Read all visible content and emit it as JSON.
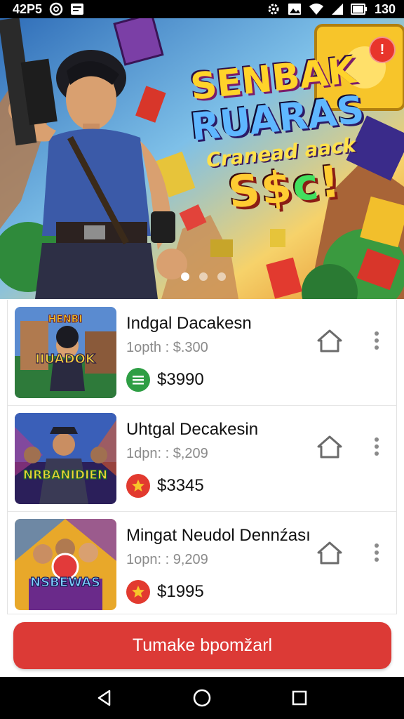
{
  "status_bar": {
    "left_text": "42P5",
    "right_text": "130",
    "icons": [
      "at-icon",
      "app-icon",
      "settings-icon",
      "image-icon",
      "wifi-icon",
      "signal-icon",
      "battery-icon"
    ]
  },
  "hero": {
    "title_line1": "SENBAK",
    "title_line2": "RUARAS",
    "title_line3": "Cranead aack",
    "title_line4_a": "S$",
    "title_line4_b": "c",
    "title_line4_c": "!",
    "badge": "!",
    "carousel_active_index": 0,
    "carousel_count": 3
  },
  "items": [
    {
      "title": "Indgal Dacakesn",
      "subtitle": "1opth : $.300",
      "price": "$3990",
      "price_icon": "list-icon",
      "price_icon_color": "#2e9e44",
      "thumb_text_top": "HENBI",
      "thumb_text": "IIUADOK"
    },
    {
      "title": "Uhtgal Decakesin",
      "subtitle": "1dpn: : $,209",
      "price": "$3345",
      "price_icon": "star-icon",
      "price_icon_color": "#e23a2f",
      "thumb_text": "NRBANIDIEN"
    },
    {
      "title": "Mingat Neudol Dennźası",
      "subtitle": "1opn: : 9,209",
      "price": "$1995",
      "price_icon": "star-icon",
      "price_icon_color": "#e23a2f",
      "thumb_text": "NSBEWAS"
    }
  ],
  "action": {
    "primary_label": "Tumake bpomžarl",
    "color": "#dc3a36"
  },
  "nav": {
    "icons": [
      "back-icon",
      "home-circle-icon",
      "recents-icon"
    ]
  }
}
